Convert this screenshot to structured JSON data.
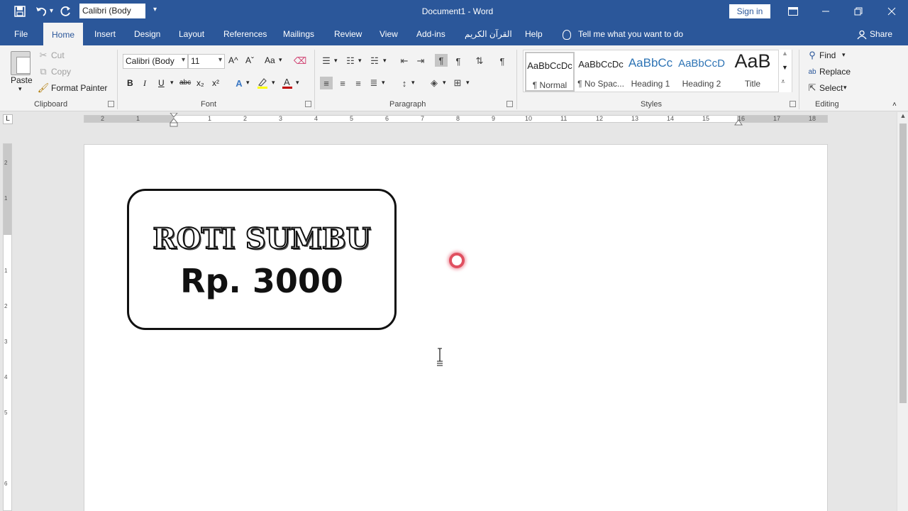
{
  "titlebar": {
    "font_name": "Calibri (Body",
    "doc_title": "Document1  -  Word",
    "signin": "Sign in",
    "icons": [
      "save-icon",
      "undo-icon",
      "redo-icon",
      "customize-qat-icon",
      "ribbon-display-icon",
      "minimize-icon",
      "restore-icon",
      "close-icon"
    ]
  },
  "tabs": [
    {
      "label": "File"
    },
    {
      "label": "Home"
    },
    {
      "label": "Insert"
    },
    {
      "label": "Design"
    },
    {
      "label": "Layout"
    },
    {
      "label": "References"
    },
    {
      "label": "Mailings"
    },
    {
      "label": "Review"
    },
    {
      "label": "View"
    },
    {
      "label": "Add-ins"
    },
    {
      "label": "القرآن الكريم"
    },
    {
      "label": "Help"
    }
  ],
  "active_tab": "Home",
  "tell_me": "Tell me what you want to do",
  "share": "Share",
  "clipboard": {
    "label": "Clipboard",
    "paste": "Paste",
    "cut": "Cut",
    "copy": "Copy",
    "format_painter": "Format Painter"
  },
  "font": {
    "label": "Font",
    "name": "Calibri (Body",
    "size": "11",
    "buttons": {
      "bold": "B",
      "italic": "I",
      "underline": "U",
      "strike": "abc",
      "sub": "x₂",
      "sup": "x²",
      "grow": "A^",
      "shrink": "Aˇ",
      "case": "Aa"
    }
  },
  "paragraph": {
    "label": "Paragraph"
  },
  "styles": {
    "label": "Styles",
    "items": [
      {
        "sample": "AaBbCcDc",
        "name": "¶ Normal"
      },
      {
        "sample": "AaBbCcDc",
        "name": "¶ No Spac..."
      },
      {
        "sample": "AaBbCc",
        "name": "Heading 1"
      },
      {
        "sample": "AaBbCcD",
        "name": "Heading 2"
      },
      {
        "sample": "AaB",
        "name": "Title"
      }
    ]
  },
  "editing": {
    "label": "Editing",
    "find": "Find",
    "replace": "Replace",
    "select": "Select"
  },
  "ruler": {
    "numbers": [
      "2",
      "1",
      "1",
      "2",
      "3",
      "4",
      "5",
      "6",
      "7",
      "8",
      "9",
      "10",
      "11",
      "12",
      "13",
      "14",
      "15",
      "16",
      "17",
      "18"
    ],
    "vnumbers": [
      "2",
      "1",
      "1",
      "2",
      "3",
      "4",
      "5",
      "6"
    ],
    "tab_selector": "L"
  },
  "document": {
    "label_title": "ROTI SUMBU",
    "label_price": "Rp. 3000"
  },
  "colors": {
    "accent": "#2b579a",
    "ribbon": "#f3f3f3",
    "font_color_bar": "#c00000",
    "highlight_bar": "#ffff00"
  }
}
